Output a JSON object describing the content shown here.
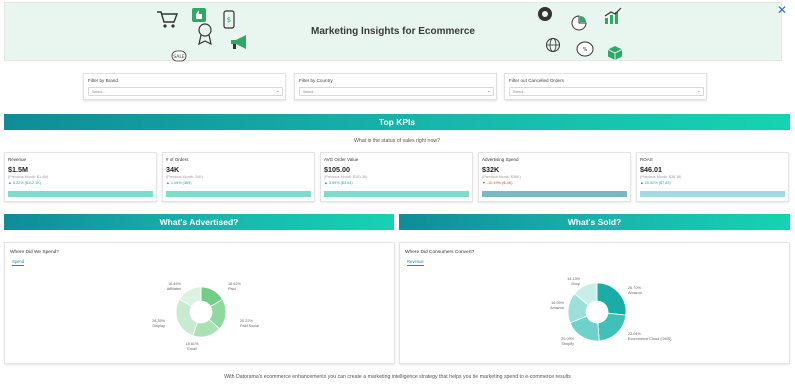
{
  "banner": {
    "title": "Marketing Insights for Ecommerce",
    "close_icon": "close-icon",
    "decor_icons": [
      "shopping-cart-icon",
      "thumbs-up-icon",
      "award-ribbon-icon",
      "price-tag-icon",
      "megaphone-icon",
      "sale-tag-icon",
      "coin-icon",
      "pie-chart-icon",
      "growth-chart-icon",
      "globe-icon",
      "percent-off-badge-icon",
      "package-box-icon"
    ]
  },
  "filters": [
    {
      "label": "Filter by Brand",
      "placeholder": "Select..."
    },
    {
      "label": "Filter by Country",
      "placeholder": "Select..."
    },
    {
      "label": "Filter out Cancelled Orders",
      "placeholder": "Select..."
    }
  ],
  "top_kpis": {
    "heading": "Top KPIs",
    "question": "What is the status of sales right now?"
  },
  "kpis": [
    {
      "label": "Revenue",
      "value": "$1.5M",
      "previous": "(Previous Month: $1.4M)",
      "change": "▲ 8.22% ($112.1K)",
      "direction": "up",
      "bar_color": "#7fdccb",
      "bar_level": 1.0
    },
    {
      "label": "# of Orders",
      "value": "34K",
      "previous": "(Previous Month: 34K)",
      "change": "▲ 1.09% (369)",
      "direction": "up",
      "bar_color": "#7fdccb",
      "bar_level": 1.0
    },
    {
      "label": "AVG Order Value",
      "value": "$105.00",
      "previous": "(Previous Month: $101.36)",
      "change": "▲ 3.59% ($3.64)",
      "direction": "up",
      "bar_color": "#7fdccb",
      "bar_level": 1.0
    },
    {
      "label": "Advertising Spend",
      "value": "$32K",
      "previous": "(Previous Month: $36K)",
      "change": "▼ -10.19% ($-4K)",
      "direction": "down",
      "bar_color": "#7fb6c2",
      "bar_level": 1.0
    },
    {
      "label": "ROAS",
      "value": "$46.01",
      "previous": "(Previous Month: $38.18)",
      "change": "▲ 20.50% ($7.83)",
      "direction": "up",
      "bar_color": "#a7d8e2",
      "bar_level": 1.0
    }
  ],
  "advertised": {
    "heading": "What's Advertised?",
    "panel_title": "Where Did We Spend?",
    "tab": "Spend",
    "chart_data": {
      "type": "pie",
      "variant": "donut",
      "labels": [
        "Paid",
        "Paid Social",
        "Email",
        "Display",
        "Affiliates"
      ],
      "values": [
        16.62,
        20.22,
        18.61,
        28.35,
        16.46
      ],
      "value_labels": [
        "16.62%",
        "20.22%",
        "18.61%",
        "28.35%",
        "16.46%"
      ],
      "colors": [
        "#72cd86",
        "#8fd9a0",
        "#a9e2b3",
        "#c8ebd0",
        "#dcf2e2"
      ]
    }
  },
  "sold": {
    "heading": "What's Sold?",
    "panel_title": "Where Did Consumers Convert?",
    "tab": "Revenue",
    "chart_data": {
      "type": "pie",
      "variant": "donut",
      "labels": [
        "Amazon",
        "Ecommerce Cloud (OMS)",
        "Shopify",
        "Amazon",
        "Shop"
      ],
      "values": [
        26.7,
        22.04,
        20.09,
        16.95,
        14.12
      ],
      "value_labels": [
        "26.70%",
        "22.04%",
        "20.09%",
        "16.95%",
        "14.13%"
      ],
      "colors": [
        "#1aada8",
        "#3fc1b8",
        "#6dd2c9",
        "#9be0d9",
        "#c8eeea"
      ]
    }
  },
  "footer": {
    "text": "With Datorama's ecommerce enhancements you can create a marketing intelligence strategy that helps you tie marketing spend to e-commerce results"
  }
}
